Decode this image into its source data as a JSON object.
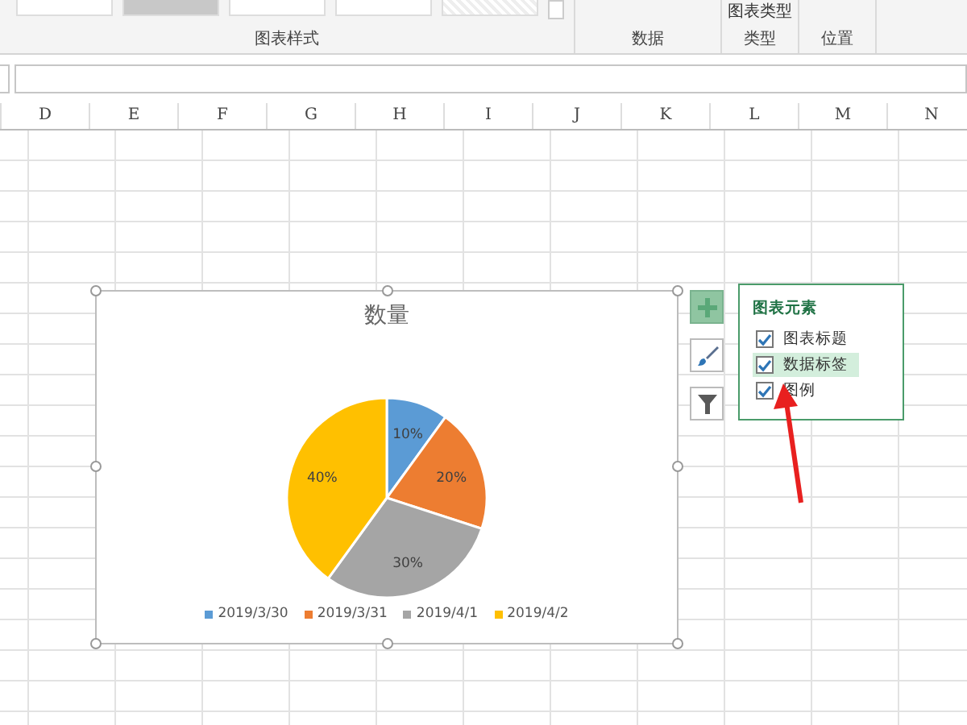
{
  "ribbon": {
    "groups": [
      {
        "label": "图表样式"
      },
      {
        "label": "数据"
      },
      {
        "label": "类型",
        "buttons": [
          "图表类型"
        ]
      },
      {
        "label": "位置"
      }
    ]
  },
  "columns": [
    "D",
    "E",
    "F",
    "G",
    "H",
    "I",
    "J",
    "K",
    "L",
    "M",
    "N"
  ],
  "chart": {
    "chart_data": {
      "type": "pie",
      "title": "数量",
      "categories": [
        "2019/3/30",
        "2019/3/31",
        "2019/4/1",
        "2019/4/2"
      ],
      "series": [
        {
          "values": [
            10,
            20,
            30,
            40
          ]
        }
      ],
      "colors": [
        "#5b9bd5",
        "#ed7d31",
        "#a5a5a5",
        "#ffc000"
      ],
      "value_labels": [
        "10%",
        "20%",
        "30%",
        "40%"
      ]
    }
  },
  "elements_popup": {
    "title": "图表元素",
    "items": [
      {
        "label": "图表标题",
        "checked": true,
        "selected": false
      },
      {
        "label": "数据标签",
        "checked": true,
        "selected": true
      },
      {
        "label": "图例",
        "checked": true,
        "selected": false
      }
    ]
  }
}
